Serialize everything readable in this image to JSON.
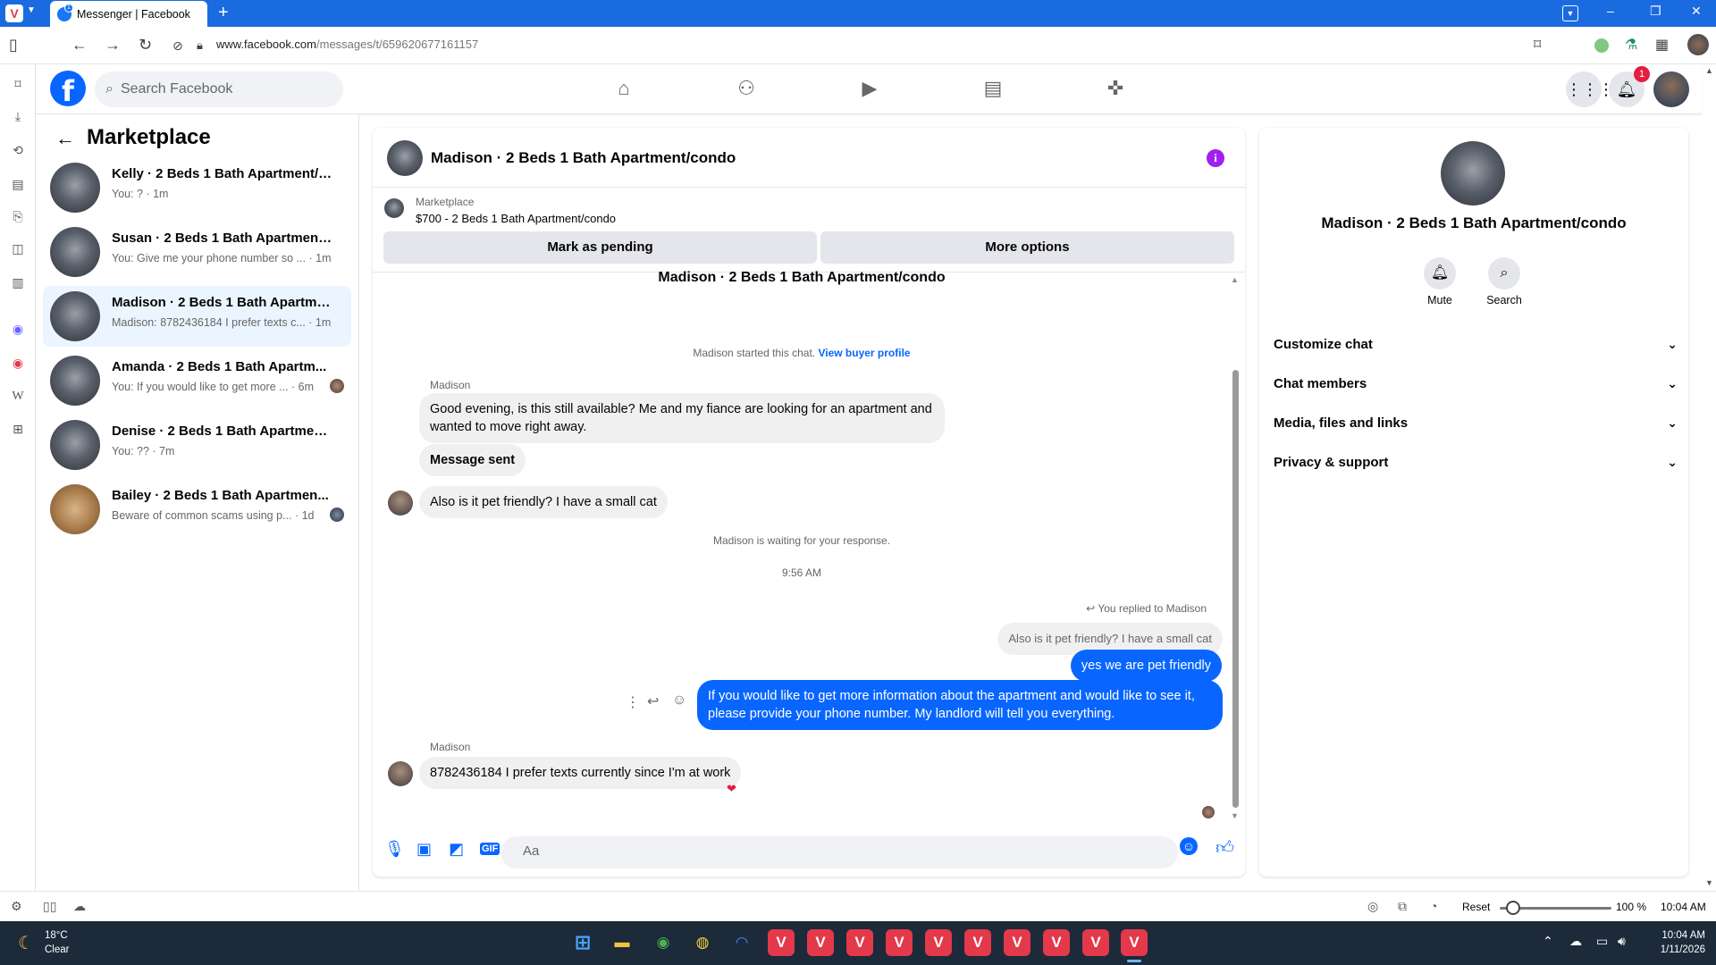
{
  "browser": {
    "tab_title": "Messenger | Facebook",
    "tab_badge": "1",
    "url_host": "www.facebook.com",
    "url_path": "/messages/t/659620677161157",
    "new_tab_symbol": "+",
    "window_controls": [
      "–",
      "❐",
      "✕"
    ]
  },
  "facebook_header": {
    "logo_letter": "f",
    "search_placeholder": "Search Facebook",
    "notification_count": "1",
    "nav_icons": [
      "home-icon",
      "friends-icon",
      "video-icon",
      "marketplace-icon",
      "gaming-icon"
    ]
  },
  "chat_list": {
    "title": "Marketplace",
    "items": [
      {
        "name": "Kelly · 2 Beds 1 Bath Apartment/co...",
        "preview": "You: ? · 1m"
      },
      {
        "name": "Susan · 2 Beds 1 Bath Apartment/c...",
        "preview": "You: Give me your phone number so ... · 1m"
      },
      {
        "name": "Madison · 2 Beds 1 Bath Apartmen...",
        "preview": "Madison: 8782436184 I prefer texts c... · 1m"
      },
      {
        "name": "Amanda · 2 Beds 1 Bath Apartm...",
        "preview": "You: If you would like to get more ... · 6m"
      },
      {
        "name": "Denise · 2 Beds 1 Bath Apartment/...",
        "preview": "You: ?? · 7m"
      },
      {
        "name": "Bailey · 2 Beds 1 Bath Apartmen...",
        "preview": "Beware of common scams using p... · 1d"
      }
    ]
  },
  "conversation": {
    "title": "Madison · 2 Beds 1 Bath Apartment/condo",
    "marketplace_label": "Marketplace",
    "listing": "$700 - 2 Beds 1 Bath Apartment/condo",
    "mark_pending": "Mark as pending",
    "more_options": "More options",
    "header_center": "Madison · 2 Beds 1 Bath Apartment/condo",
    "started_text": "Madison started this chat.",
    "view_buyer": "View buyer profile",
    "sender1": "Madison",
    "msg1": "Good evening, is this still available? Me and my fiance are looking for an apartment and wanted to move right away.",
    "msg2": "Message sent",
    "msg3": "Also is it pet friendly? I have a small cat",
    "waiting": "Madison is waiting for your response.",
    "time": "9:56 AM",
    "replied_to": "You replied to Madison",
    "quoted": "Also is it pet friendly? I have a small cat",
    "out1": "yes we are pet friendly",
    "out2": "If you would like to get more information about the apartment and would like to see it, please provide your phone number. My landlord will tell you everything.",
    "sender2": "Madison",
    "msg4": "8782436184 I prefer texts currently since I'm at work",
    "composer_placeholder": "Aa"
  },
  "right_panel": {
    "name": "Madison · 2 Beds 1 Bath Apartment/condo",
    "mute": "Mute",
    "search": "Search",
    "sections": [
      "Customize chat",
      "Chat members",
      "Media, files and links",
      "Privacy & support"
    ]
  },
  "status_bar": {
    "reset": "Reset",
    "zoom": "100 %",
    "zoom_fraction": 0.12,
    "time": "10:04 AM"
  },
  "taskbar": {
    "temp": "18°C",
    "condition": "Clear",
    "time": "10:04 AM",
    "date": "1/11/2026"
  },
  "colors": {
    "fb_blue": "#0866ff",
    "titlebar": "#1a6be0",
    "taskbar": "#1c2a3a"
  }
}
